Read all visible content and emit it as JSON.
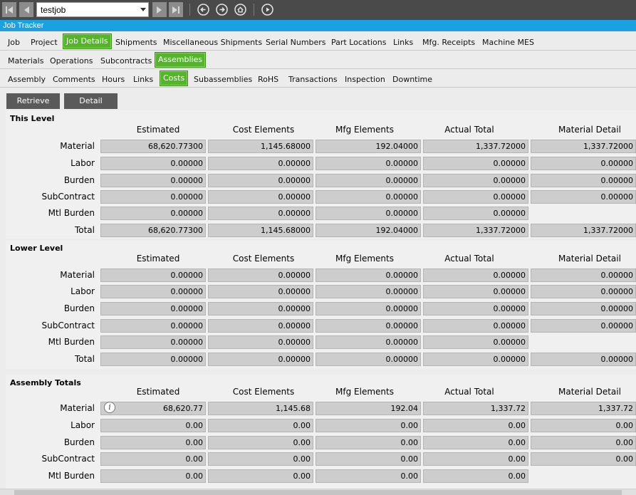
{
  "toolbar": {
    "record_value": "testjob",
    "icons": [
      "first-record-icon",
      "previous-record-icon",
      "dropdown-arrow-icon",
      "next-record-icon",
      "last-record-icon",
      "back-icon",
      "forward-icon",
      "home-icon",
      "play-icon"
    ]
  },
  "window_title": "Job Tracker",
  "tabs_row1": [
    {
      "label": "Job",
      "active": false
    },
    {
      "label": "Project",
      "active": false
    },
    {
      "label": "Job Details",
      "active": true
    },
    {
      "label": "Shipments",
      "active": false
    },
    {
      "label": "Miscellaneous Shipments",
      "active": false
    },
    {
      "label": "Serial Numbers",
      "active": false
    },
    {
      "label": "Part Locations",
      "active": false
    },
    {
      "label": "Links",
      "active": false
    },
    {
      "label": "Mfg. Receipts",
      "active": false
    },
    {
      "label": "Machine MES",
      "active": false
    }
  ],
  "tabs_row2": [
    {
      "label": "Materials",
      "active": false
    },
    {
      "label": "Operations",
      "active": false
    },
    {
      "label": "Subcontracts",
      "active": false
    },
    {
      "label": "Assemblies",
      "active": true
    }
  ],
  "tabs_row3": [
    {
      "label": "Assembly",
      "active": false
    },
    {
      "label": "Comments",
      "active": false
    },
    {
      "label": "Hours",
      "active": false
    },
    {
      "label": "Links",
      "active": false
    },
    {
      "label": "Costs",
      "active": true
    },
    {
      "label": "Subassemblies",
      "active": false
    },
    {
      "label": "RoHS",
      "active": false
    },
    {
      "label": "Transactions",
      "active": false
    },
    {
      "label": "Inspection",
      "active": false
    },
    {
      "label": "Downtime",
      "active": false
    }
  ],
  "buttons": {
    "retrieve": "Retrieve",
    "detail": "Detail"
  },
  "columns": [
    "Estimated",
    "Cost Elements",
    "Mfg Elements",
    "Actual Total",
    "Material Detail"
  ],
  "sections": [
    {
      "title": "This Level",
      "rows": [
        {
          "label": "Material",
          "values": [
            "68,620.77300",
            "1,145.68000",
            "192.04000",
            "1,337.72000",
            "1,337.72000"
          ]
        },
        {
          "label": "Labor",
          "values": [
            "0.00000",
            "0.00000",
            "0.00000",
            "0.00000",
            "0.00000"
          ]
        },
        {
          "label": "Burden",
          "values": [
            "0.00000",
            "0.00000",
            "0.00000",
            "0.00000",
            "0.00000"
          ]
        },
        {
          "label": "SubContract",
          "values": [
            "0.00000",
            "0.00000",
            "0.00000",
            "0.00000",
            "0.00000"
          ]
        },
        {
          "label": "Mtl Burden",
          "values": [
            "0.00000",
            "0.00000",
            "0.00000",
            "0.00000",
            null
          ]
        },
        {
          "label": "Total",
          "values": [
            "68,620.77300",
            "1,145.68000",
            "192.04000",
            "1,337.72000",
            "1,337.72000"
          ]
        }
      ]
    },
    {
      "title": "Lower Level",
      "rows": [
        {
          "label": "Material",
          "values": [
            "0.00000",
            "0.00000",
            "0.00000",
            "0.00000",
            "0.00000"
          ]
        },
        {
          "label": "Labor",
          "values": [
            "0.00000",
            "0.00000",
            "0.00000",
            "0.00000",
            "0.00000"
          ]
        },
        {
          "label": "Burden",
          "values": [
            "0.00000",
            "0.00000",
            "0.00000",
            "0.00000",
            "0.00000"
          ]
        },
        {
          "label": "SubContract",
          "values": [
            "0.00000",
            "0.00000",
            "0.00000",
            "0.00000",
            "0.00000"
          ]
        },
        {
          "label": "Mtl Burden",
          "values": [
            "0.00000",
            "0.00000",
            "0.00000",
            "0.00000",
            null
          ]
        },
        {
          "label": "Total",
          "values": [
            "0.00000",
            "0.00000",
            "0.00000",
            "0.00000",
            "0.00000"
          ]
        }
      ]
    },
    {
      "title": "Assembly Totals",
      "rows": [
        {
          "label": "Material",
          "values": [
            "68,620.77",
            "1,145.68",
            "192.04",
            "1,337.72",
            "1,337.72"
          ]
        },
        {
          "label": "Labor",
          "values": [
            "0.00",
            "0.00",
            "0.00",
            "0.00",
            "0.00"
          ]
        },
        {
          "label": "Burden",
          "values": [
            "0.00",
            "0.00",
            "0.00",
            "0.00",
            "0.00"
          ]
        },
        {
          "label": "SubContract",
          "values": [
            "0.00",
            "0.00",
            "0.00",
            "0.00",
            "0.00"
          ]
        },
        {
          "label": "Mtl Burden",
          "values": [
            "0.00",
            "0.00",
            "0.00",
            "0.00",
            null
          ]
        }
      ]
    }
  ]
}
